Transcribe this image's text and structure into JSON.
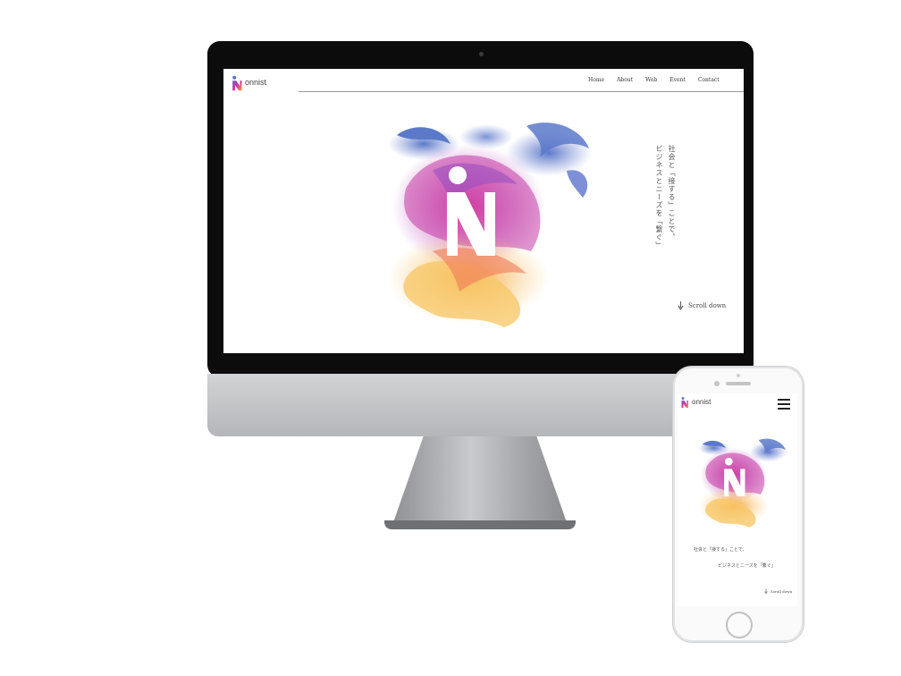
{
  "desktop": {
    "brand": "onnist",
    "nav": [
      "Home",
      "About",
      "Web",
      "Event",
      "Contact"
    ],
    "tagline_lines": [
      "社会と「接する」ことで、",
      "ビジネスとニーズを「繋ぐ」"
    ],
    "scroll_label": "Scroll down"
  },
  "mobile": {
    "brand": "onnist",
    "tagline_lines": [
      "社会と「接する」ことで、",
      "ビジネスとニーズを「繋ぐ」"
    ],
    "scroll_label": "Scroll down"
  },
  "icons": {
    "logo": "onnist-logo-icon",
    "menu": "hamburger-menu-icon",
    "scroll": "arrow-down-icon"
  },
  "colors": {
    "accent_blue": "#5b79c9",
    "accent_magenta": "#d6329a",
    "accent_purple": "#9b4fc0",
    "accent_orange": "#f5a03a",
    "accent_yellow": "#f8c86a"
  }
}
